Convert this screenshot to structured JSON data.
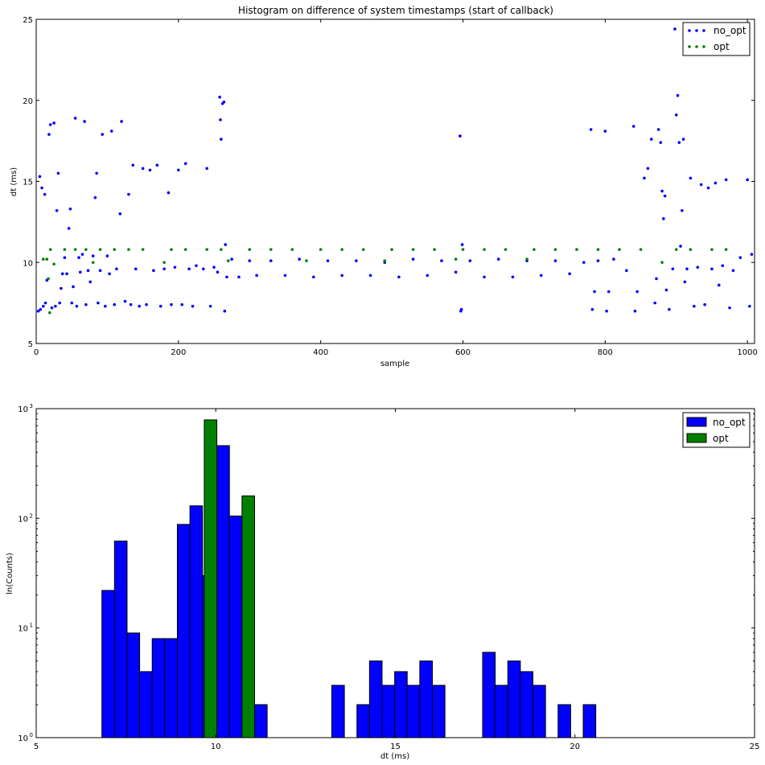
{
  "chart_data": [
    {
      "type": "scatter",
      "title": "Histogram on difference of system timestamps (start of callback)",
      "xlabel": "sample",
      "ylabel": "dt (ms)",
      "xlim": [
        0,
        1010
      ],
      "ylim": [
        5,
        25
      ],
      "xticks": [
        0,
        200,
        400,
        600,
        800,
        1000
      ],
      "xtick_labels": [
        "0",
        "200",
        "400",
        "600",
        "800",
        "1000"
      ],
      "yticks": [
        5,
        10,
        15,
        20,
        25
      ],
      "ytick_labels": [
        "5",
        "10",
        "15",
        "20",
        "25"
      ],
      "grid": false,
      "legend_position": "top-right",
      "series": [
        {
          "name": "no_opt",
          "color": "#0000ff",
          "points": [
            [
              3,
              7.0
            ],
            [
              5,
              15.3
            ],
            [
              6,
              7.1
            ],
            [
              8,
              14.6
            ],
            [
              10,
              7.3
            ],
            [
              12,
              14.2
            ],
            [
              13,
              7.5
            ],
            [
              15,
              8.9
            ],
            [
              18,
              17.9
            ],
            [
              20,
              18.5
            ],
            [
              22,
              7.2
            ],
            [
              25,
              18.6
            ],
            [
              27,
              7.3
            ],
            [
              29,
              13.2
            ],
            [
              31,
              15.5
            ],
            [
              33,
              7.5
            ],
            [
              35,
              8.4
            ],
            [
              37,
              9.3
            ],
            [
              40,
              10.3
            ],
            [
              43,
              9.3
            ],
            [
              46,
              12.1
            ],
            [
              48,
              13.3
            ],
            [
              50,
              7.5
            ],
            [
              52,
              8.5
            ],
            [
              55,
              18.9
            ],
            [
              57,
              7.3
            ],
            [
              60,
              10.3
            ],
            [
              62,
              9.4
            ],
            [
              65,
              10.5
            ],
            [
              68,
              18.7
            ],
            [
              70,
              7.4
            ],
            [
              73,
              9.5
            ],
            [
              76,
              8.8
            ],
            [
              80,
              10.4
            ],
            [
              83,
              14.0
            ],
            [
              85,
              15.5
            ],
            [
              87,
              7.5
            ],
            [
              90,
              9.5
            ],
            [
              93,
              17.9
            ],
            [
              97,
              7.3
            ],
            [
              100,
              10.4
            ],
            [
              103,
              9.3
            ],
            [
              106,
              18.1
            ],
            [
              110,
              7.4
            ],
            [
              113,
              9.6
            ],
            [
              118,
              13.0
            ],
            [
              120,
              18.7
            ],
            [
              125,
              7.6
            ],
            [
              130,
              14.2
            ],
            [
              133,
              7.4
            ],
            [
              136,
              16.0
            ],
            [
              140,
              9.6
            ],
            [
              145,
              7.3
            ],
            [
              150,
              15.8
            ],
            [
              155,
              7.4
            ],
            [
              160,
              15.7
            ],
            [
              165,
              9.5
            ],
            [
              170,
              16.0
            ],
            [
              175,
              7.3
            ],
            [
              180,
              9.6
            ],
            [
              186,
              14.3
            ],
            [
              190,
              7.4
            ],
            [
              195,
              9.7
            ],
            [
              200,
              15.7
            ],
            [
              205,
              7.4
            ],
            [
              210,
              16.1
            ],
            [
              215,
              9.6
            ],
            [
              220,
              7.3
            ],
            [
              225,
              9.8
            ],
            [
              235,
              9.6
            ],
            [
              240,
              15.8
            ],
            [
              245,
              7.3
            ],
            [
              250,
              9.7
            ],
            [
              255,
              9.4
            ],
            [
              258,
              20.2
            ],
            [
              259,
              18.8
            ],
            [
              260,
              17.6
            ],
            [
              262,
              19.8
            ],
            [
              264,
              19.9
            ],
            [
              265,
              7.0
            ],
            [
              266,
              11.1
            ],
            [
              268,
              9.1
            ],
            [
              275,
              10.2
            ],
            [
              285,
              9.1
            ],
            [
              300,
              10.1
            ],
            [
              310,
              9.2
            ],
            [
              330,
              10.1
            ],
            [
              350,
              9.2
            ],
            [
              370,
              10.2
            ],
            [
              390,
              9.1
            ],
            [
              410,
              10.1
            ],
            [
              430,
              9.2
            ],
            [
              450,
              10.1
            ],
            [
              470,
              9.2
            ],
            [
              490,
              10.0
            ],
            [
              510,
              9.1
            ],
            [
              530,
              10.2
            ],
            [
              550,
              9.2
            ],
            [
              570,
              10.1
            ],
            [
              590,
              9.4
            ],
            [
              596,
              17.8
            ],
            [
              597,
              7.0
            ],
            [
              598,
              7.1
            ],
            [
              599,
              11.1
            ],
            [
              610,
              10.1
            ],
            [
              630,
              9.1
            ],
            [
              650,
              10.2
            ],
            [
              670,
              9.1
            ],
            [
              690,
              10.1
            ],
            [
              710,
              9.2
            ],
            [
              730,
              10.1
            ],
            [
              750,
              9.3
            ],
            [
              770,
              10.0
            ],
            [
              780,
              18.2
            ],
            [
              782,
              7.1
            ],
            [
              785,
              8.2
            ],
            [
              790,
              10.1
            ],
            [
              800,
              18.1
            ],
            [
              802,
              7.0
            ],
            [
              805,
              8.2
            ],
            [
              812,
              10.2
            ],
            [
              830,
              9.5
            ],
            [
              840,
              18.4
            ],
            [
              842,
              7.0
            ],
            [
              845,
              8.2
            ],
            [
              855,
              15.2
            ],
            [
              860,
              15.8
            ],
            [
              865,
              17.6
            ],
            [
              870,
              7.5
            ],
            [
              872,
              9.0
            ],
            [
              875,
              18.2
            ],
            [
              878,
              17.4
            ],
            [
              880,
              14.4
            ],
            [
              882,
              12.7
            ],
            [
              884,
              14.1
            ],
            [
              886,
              8.3
            ],
            [
              890,
              7.1
            ],
            [
              895,
              9.6
            ],
            [
              898,
              24.4
            ],
            [
              900,
              19.1
            ],
            [
              902,
              20.3
            ],
            [
              904,
              17.4
            ],
            [
              906,
              11.0
            ],
            [
              908,
              13.2
            ],
            [
              910,
              17.6
            ],
            [
              912,
              8.8
            ],
            [
              915,
              9.6
            ],
            [
              920,
              15.2
            ],
            [
              925,
              7.3
            ],
            [
              930,
              9.7
            ],
            [
              935,
              14.8
            ],
            [
              940,
              7.4
            ],
            [
              945,
              14.6
            ],
            [
              950,
              9.6
            ],
            [
              955,
              14.9
            ],
            [
              960,
              8.6
            ],
            [
              965,
              9.8
            ],
            [
              970,
              15.1
            ],
            [
              975,
              7.2
            ],
            [
              980,
              9.5
            ],
            [
              990,
              10.3
            ],
            [
              1000,
              15.1
            ],
            [
              1003,
              7.3
            ],
            [
              1006,
              10.5
            ]
          ]
        },
        {
          "name": "opt",
          "color": "#008000",
          "points": [
            [
              10,
              10.2
            ],
            [
              15,
              10.2
            ],
            [
              17,
              9.0
            ],
            [
              19,
              6.9
            ],
            [
              20,
              10.8
            ],
            [
              25,
              9.9
            ],
            [
              40,
              10.8
            ],
            [
              55,
              10.8
            ],
            [
              70,
              10.8
            ],
            [
              80,
              10.0
            ],
            [
              90,
              10.8
            ],
            [
              110,
              10.8
            ],
            [
              130,
              10.8
            ],
            [
              150,
              10.8
            ],
            [
              180,
              10.0
            ],
            [
              190,
              10.8
            ],
            [
              210,
              10.8
            ],
            [
              240,
              10.8
            ],
            [
              260,
              10.8
            ],
            [
              270,
              10.1
            ],
            [
              300,
              10.8
            ],
            [
              330,
              10.8
            ],
            [
              360,
              10.8
            ],
            [
              380,
              10.1
            ],
            [
              400,
              10.8
            ],
            [
              430,
              10.8
            ],
            [
              460,
              10.8
            ],
            [
              490,
              10.1
            ],
            [
              500,
              10.8
            ],
            [
              530,
              10.8
            ],
            [
              560,
              10.8
            ],
            [
              590,
              10.2
            ],
            [
              600,
              10.8
            ],
            [
              630,
              10.8
            ],
            [
              660,
              10.8
            ],
            [
              690,
              10.2
            ],
            [
              700,
              10.8
            ],
            [
              730,
              10.8
            ],
            [
              760,
              10.8
            ],
            [
              790,
              10.8
            ],
            [
              820,
              10.8
            ],
            [
              850,
              10.8
            ],
            [
              880,
              10.0
            ],
            [
              900,
              10.8
            ],
            [
              920,
              10.8
            ],
            [
              950,
              10.8
            ],
            [
              970,
              10.8
            ]
          ]
        }
      ]
    },
    {
      "type": "bar",
      "xlabel": "dt (ms)",
      "ylabel": "ln(Counts)",
      "xlim": [
        5,
        25
      ],
      "ylim": [
        1,
        1000
      ],
      "yscale": "log",
      "xticks": [
        5,
        10,
        15,
        20,
        25
      ],
      "xtick_labels": [
        "5",
        "10",
        "15",
        "20",
        "25"
      ],
      "yticks": [
        1,
        10,
        100,
        1000
      ],
      "ytick_base": "10",
      "ytick_exponents": [
        "0",
        "1",
        "2",
        "3"
      ],
      "grid": false,
      "legend_position": "top-right",
      "series": [
        {
          "name": "no_opt",
          "color": "#0000ff",
          "bins": [
            [
              6.83,
              7.18,
              22
            ],
            [
              7.18,
              7.53,
              62
            ],
            [
              7.53,
              7.88,
              9
            ],
            [
              7.88,
              8.23,
              4
            ],
            [
              8.23,
              8.58,
              8
            ],
            [
              8.58,
              8.93,
              8
            ],
            [
              8.93,
              9.28,
              88
            ],
            [
              9.28,
              9.63,
              130
            ],
            [
              9.63,
              9.98,
              30
            ],
            [
              10.03,
              10.38,
              460
            ],
            [
              10.38,
              10.73,
              105
            ],
            [
              10.73,
              11.08,
              1
            ],
            [
              11.08,
              11.43,
              2
            ],
            [
              13.23,
              13.58,
              3
            ],
            [
              13.93,
              14.28,
              2
            ],
            [
              14.28,
              14.63,
              5
            ],
            [
              14.63,
              14.98,
              3
            ],
            [
              14.98,
              15.33,
              4
            ],
            [
              15.33,
              15.68,
              3
            ],
            [
              15.68,
              16.03,
              5
            ],
            [
              16.03,
              16.38,
              3
            ],
            [
              17.43,
              17.78,
              6
            ],
            [
              17.78,
              18.13,
              3
            ],
            [
              18.13,
              18.48,
              5
            ],
            [
              18.48,
              18.83,
              4
            ],
            [
              18.83,
              19.18,
              3
            ],
            [
              19.53,
              19.88,
              2
            ],
            [
              20.23,
              20.58,
              2
            ]
          ]
        },
        {
          "name": "opt",
          "color": "#008000",
          "bins": [
            [
              9.68,
              10.03,
              790
            ],
            [
              10.73,
              11.08,
              160
            ]
          ]
        }
      ]
    }
  ]
}
